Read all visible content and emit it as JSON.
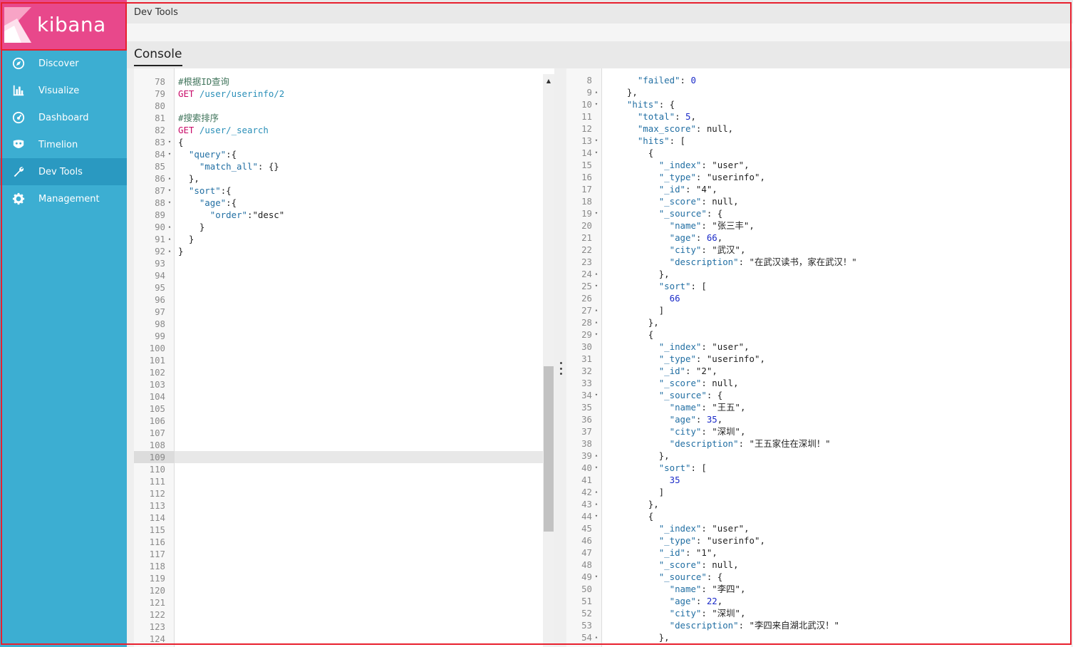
{
  "app": {
    "logo_text": "kibana",
    "brand_color": "#e8488b",
    "sidebar_color": "#3caed2"
  },
  "sidebar": {
    "items": [
      {
        "label": "Discover",
        "icon": "compass-icon"
      },
      {
        "label": "Visualize",
        "icon": "bar-chart-icon"
      },
      {
        "label": "Dashboard",
        "icon": "dashboard-gauge-icon"
      },
      {
        "label": "Timelion",
        "icon": "timelion-mask-icon"
      },
      {
        "label": "Dev Tools",
        "icon": "wrench-icon",
        "active": true
      },
      {
        "label": "Management",
        "icon": "gear-icon"
      }
    ]
  },
  "header": {
    "title": "Dev Tools",
    "tab": "Console"
  },
  "request_editor": {
    "active_line": 109,
    "lines": [
      {
        "n": 78,
        "f": "",
        "t": "#根据ID查询",
        "k": "comment"
      },
      {
        "n": 79,
        "f": "",
        "t": "GET /user/userinfo/2",
        "k": "request"
      },
      {
        "n": 80,
        "f": "",
        "t": "",
        "k": ""
      },
      {
        "n": 81,
        "f": "",
        "t": "#搜索排序",
        "k": "comment"
      },
      {
        "n": 82,
        "f": "",
        "t": "GET /user/_search",
        "k": "request"
      },
      {
        "n": 83,
        "f": "▾",
        "t": "{",
        "k": "json"
      },
      {
        "n": 84,
        "f": "▾",
        "t": "  \"query\":{",
        "k": "json"
      },
      {
        "n": 85,
        "f": "",
        "t": "    \"match_all\": {}",
        "k": "json"
      },
      {
        "n": 86,
        "f": "▴",
        "t": "  },",
        "k": "json"
      },
      {
        "n": 87,
        "f": "▾",
        "t": "  \"sort\":{",
        "k": "json"
      },
      {
        "n": 88,
        "f": "▾",
        "t": "    \"age\":{",
        "k": "json"
      },
      {
        "n": 89,
        "f": "",
        "t": "      \"order\":\"desc\"",
        "k": "json"
      },
      {
        "n": 90,
        "f": "▴",
        "t": "    }",
        "k": "json"
      },
      {
        "n": 91,
        "f": "▴",
        "t": "  }",
        "k": "json"
      },
      {
        "n": 92,
        "f": "▴",
        "t": "}",
        "k": "json"
      },
      {
        "n": 93,
        "f": "",
        "t": "",
        "k": ""
      },
      {
        "n": 94,
        "f": "",
        "t": "",
        "k": ""
      },
      {
        "n": 95,
        "f": "",
        "t": "",
        "k": ""
      },
      {
        "n": 96,
        "f": "",
        "t": "",
        "k": ""
      },
      {
        "n": 97,
        "f": "",
        "t": "",
        "k": ""
      },
      {
        "n": 98,
        "f": "",
        "t": "",
        "k": ""
      },
      {
        "n": 99,
        "f": "",
        "t": "",
        "k": ""
      },
      {
        "n": 100,
        "f": "",
        "t": "",
        "k": ""
      },
      {
        "n": 101,
        "f": "",
        "t": "",
        "k": ""
      },
      {
        "n": 102,
        "f": "",
        "t": "",
        "k": ""
      },
      {
        "n": 103,
        "f": "",
        "t": "",
        "k": ""
      },
      {
        "n": 104,
        "f": "",
        "t": "",
        "k": ""
      },
      {
        "n": 105,
        "f": "",
        "t": "",
        "k": ""
      },
      {
        "n": 106,
        "f": "",
        "t": "",
        "k": ""
      },
      {
        "n": 107,
        "f": "",
        "t": "",
        "k": ""
      },
      {
        "n": 108,
        "f": "",
        "t": "",
        "k": ""
      },
      {
        "n": 109,
        "f": "",
        "t": "",
        "k": ""
      },
      {
        "n": 110,
        "f": "",
        "t": "",
        "k": ""
      },
      {
        "n": 111,
        "f": "",
        "t": "",
        "k": ""
      },
      {
        "n": 112,
        "f": "",
        "t": "",
        "k": ""
      },
      {
        "n": 113,
        "f": "",
        "t": "",
        "k": ""
      },
      {
        "n": 114,
        "f": "",
        "t": "",
        "k": ""
      },
      {
        "n": 115,
        "f": "",
        "t": "",
        "k": ""
      },
      {
        "n": 116,
        "f": "",
        "t": "",
        "k": ""
      },
      {
        "n": 117,
        "f": "",
        "t": "",
        "k": ""
      },
      {
        "n": 118,
        "f": "",
        "t": "",
        "k": ""
      },
      {
        "n": 119,
        "f": "",
        "t": "",
        "k": ""
      },
      {
        "n": 120,
        "f": "",
        "t": "",
        "k": ""
      },
      {
        "n": 121,
        "f": "",
        "t": "",
        "k": ""
      },
      {
        "n": 122,
        "f": "",
        "t": "",
        "k": ""
      },
      {
        "n": 123,
        "f": "",
        "t": "",
        "k": ""
      },
      {
        "n": 124,
        "f": "",
        "t": "",
        "k": ""
      }
    ]
  },
  "response_editor": {
    "lines": [
      {
        "n": 8,
        "f": "",
        "t": "    \"failed\": 0"
      },
      {
        "n": 9,
        "f": "▴",
        "t": "  },"
      },
      {
        "n": 10,
        "f": "▾",
        "t": "  \"hits\": {"
      },
      {
        "n": 11,
        "f": "",
        "t": "    \"total\": 5,"
      },
      {
        "n": 12,
        "f": "",
        "t": "    \"max_score\": null,"
      },
      {
        "n": 13,
        "f": "▾",
        "t": "    \"hits\": ["
      },
      {
        "n": 14,
        "f": "▾",
        "t": "      {"
      },
      {
        "n": 15,
        "f": "",
        "t": "        \"_index\": \"user\","
      },
      {
        "n": 16,
        "f": "",
        "t": "        \"_type\": \"userinfo\","
      },
      {
        "n": 17,
        "f": "",
        "t": "        \"_id\": \"4\","
      },
      {
        "n": 18,
        "f": "",
        "t": "        \"_score\": null,"
      },
      {
        "n": 19,
        "f": "▾",
        "t": "        \"_source\": {"
      },
      {
        "n": 20,
        "f": "",
        "t": "          \"name\": \"张三丰\","
      },
      {
        "n": 21,
        "f": "",
        "t": "          \"age\": 66,"
      },
      {
        "n": 22,
        "f": "",
        "t": "          \"city\": \"武汉\","
      },
      {
        "n": 23,
        "f": "",
        "t": "          \"description\": \"在武汉读书，家在武汉！\""
      },
      {
        "n": 24,
        "f": "▴",
        "t": "        },"
      },
      {
        "n": 25,
        "f": "▾",
        "t": "        \"sort\": ["
      },
      {
        "n": 26,
        "f": "",
        "t": "          66"
      },
      {
        "n": 27,
        "f": "▴",
        "t": "        ]"
      },
      {
        "n": 28,
        "f": "▴",
        "t": "      },"
      },
      {
        "n": 29,
        "f": "▾",
        "t": "      {"
      },
      {
        "n": 30,
        "f": "",
        "t": "        \"_index\": \"user\","
      },
      {
        "n": 31,
        "f": "",
        "t": "        \"_type\": \"userinfo\","
      },
      {
        "n": 32,
        "f": "",
        "t": "        \"_id\": \"2\","
      },
      {
        "n": 33,
        "f": "",
        "t": "        \"_score\": null,"
      },
      {
        "n": 34,
        "f": "▾",
        "t": "        \"_source\": {"
      },
      {
        "n": 35,
        "f": "",
        "t": "          \"name\": \"王五\","
      },
      {
        "n": 36,
        "f": "",
        "t": "          \"age\": 35,"
      },
      {
        "n": 37,
        "f": "",
        "t": "          \"city\": \"深圳\","
      },
      {
        "n": 38,
        "f": "",
        "t": "          \"description\": \"王五家住在深圳！\""
      },
      {
        "n": 39,
        "f": "▴",
        "t": "        },"
      },
      {
        "n": 40,
        "f": "▾",
        "t": "        \"sort\": ["
      },
      {
        "n": 41,
        "f": "",
        "t": "          35"
      },
      {
        "n": 42,
        "f": "▴",
        "t": "        ]"
      },
      {
        "n": 43,
        "f": "▴",
        "t": "      },"
      },
      {
        "n": 44,
        "f": "▾",
        "t": "      {"
      },
      {
        "n": 45,
        "f": "",
        "t": "        \"_index\": \"user\","
      },
      {
        "n": 46,
        "f": "",
        "t": "        \"_type\": \"userinfo\","
      },
      {
        "n": 47,
        "f": "",
        "t": "        \"_id\": \"1\","
      },
      {
        "n": 48,
        "f": "",
        "t": "        \"_score\": null,"
      },
      {
        "n": 49,
        "f": "▾",
        "t": "        \"_source\": {"
      },
      {
        "n": 50,
        "f": "",
        "t": "          \"name\": \"李四\","
      },
      {
        "n": 51,
        "f": "",
        "t": "          \"age\": 22,"
      },
      {
        "n": 52,
        "f": "",
        "t": "          \"city\": \"深圳\","
      },
      {
        "n": 53,
        "f": "",
        "t": "          \"description\": \"李四来自湖北武汉！\""
      },
      {
        "n": 54,
        "f": "▴",
        "t": "        },"
      }
    ]
  }
}
